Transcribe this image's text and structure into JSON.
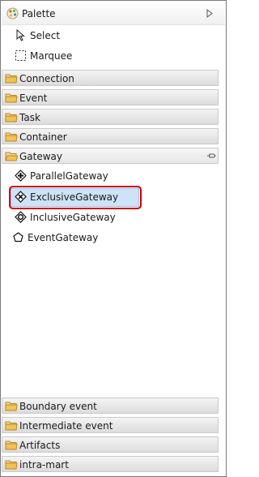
{
  "palette": {
    "title": "Palette",
    "icon": "palette-icon",
    "collapse_icon": "triangle-right-icon"
  },
  "tools": [
    {
      "label": "Select",
      "icon": "arrow-cursor-icon"
    },
    {
      "label": "Marquee",
      "icon": "marquee-icon"
    }
  ],
  "drawers_top": [
    {
      "label": "Connection",
      "icon": "folder-icon"
    },
    {
      "label": "Event",
      "icon": "folder-icon"
    },
    {
      "label": "Task",
      "icon": "folder-icon"
    },
    {
      "label": "Container",
      "icon": "folder-icon"
    }
  ],
  "gateway": {
    "label": "Gateway",
    "icon": "folder-open-icon",
    "pin_icon": "pin-icon",
    "items": [
      {
        "label": "ParallelGateway",
        "icon": "parallel-gateway-icon"
      },
      {
        "label": "ExclusiveGateway",
        "icon": "exclusive-gateway-icon",
        "selected": true
      },
      {
        "label": "InclusiveGateway",
        "icon": "inclusive-gateway-icon"
      },
      {
        "label": "EventGateway",
        "icon": "event-gateway-icon"
      }
    ]
  },
  "drawers_bottom": [
    {
      "label": "Boundary event",
      "icon": "folder-icon"
    },
    {
      "label": "Intermediate event",
      "icon": "folder-icon"
    },
    {
      "label": "Artifacts",
      "icon": "folder-icon"
    },
    {
      "label": "intra-mart",
      "icon": "folder-icon"
    }
  ],
  "colors": {
    "selection": "#cde3f7",
    "highlight": "#cc0000",
    "folder": "#f2c254"
  }
}
